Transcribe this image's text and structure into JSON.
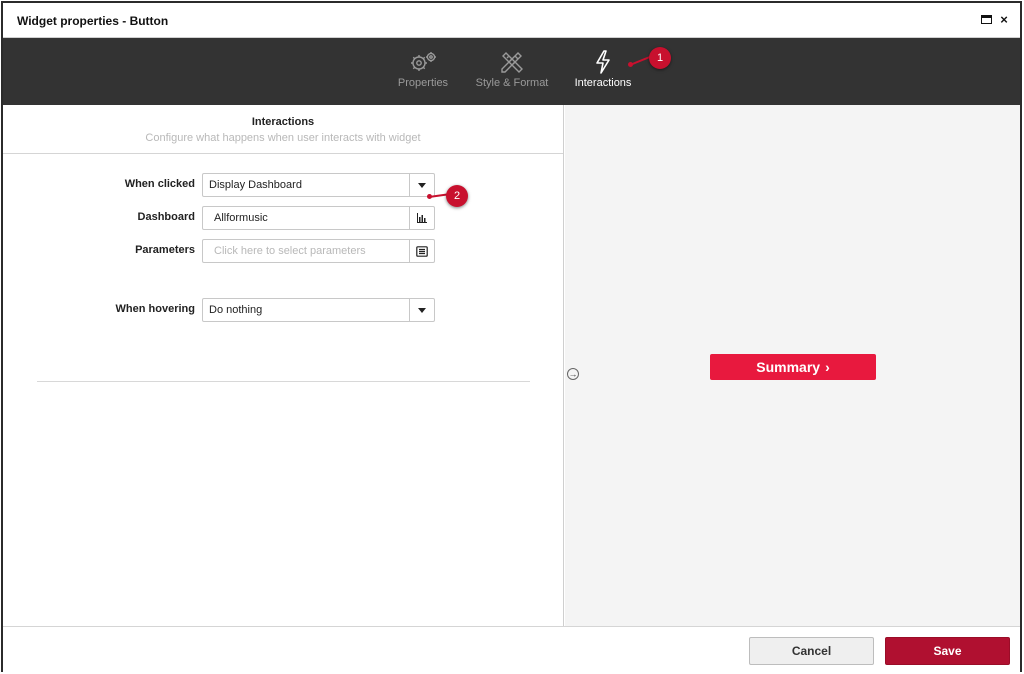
{
  "window": {
    "title": "Widget properties - Button",
    "close_glyph": "×"
  },
  "tabs": [
    {
      "label": "Properties",
      "icon": "gears-icon"
    },
    {
      "label": "Style & Format",
      "icon": "pencil-ruler-icon"
    },
    {
      "label": "Interactions",
      "icon": "lightning-icon",
      "active": true
    }
  ],
  "pane": {
    "title": "Interactions",
    "subtitle": "Configure what happens when user interacts with widget"
  },
  "form": {
    "when_clicked": {
      "label": "When clicked",
      "value": "Display Dashboard"
    },
    "dashboard": {
      "label": "Dashboard",
      "value": "Allformusic"
    },
    "parameters": {
      "label": "Parameters",
      "placeholder": "Click here to select parameters"
    },
    "when_hovering": {
      "label": "When hovering",
      "value": "Do nothing"
    }
  },
  "preview": {
    "button_label": "Summary",
    "button_color": "#e8193e",
    "chevron": "›"
  },
  "footer": {
    "cancel_label": "Cancel",
    "save_label": "Save",
    "save_color": "#b01030"
  },
  "callouts": [
    {
      "number": "1"
    },
    {
      "number": "2"
    }
  ]
}
